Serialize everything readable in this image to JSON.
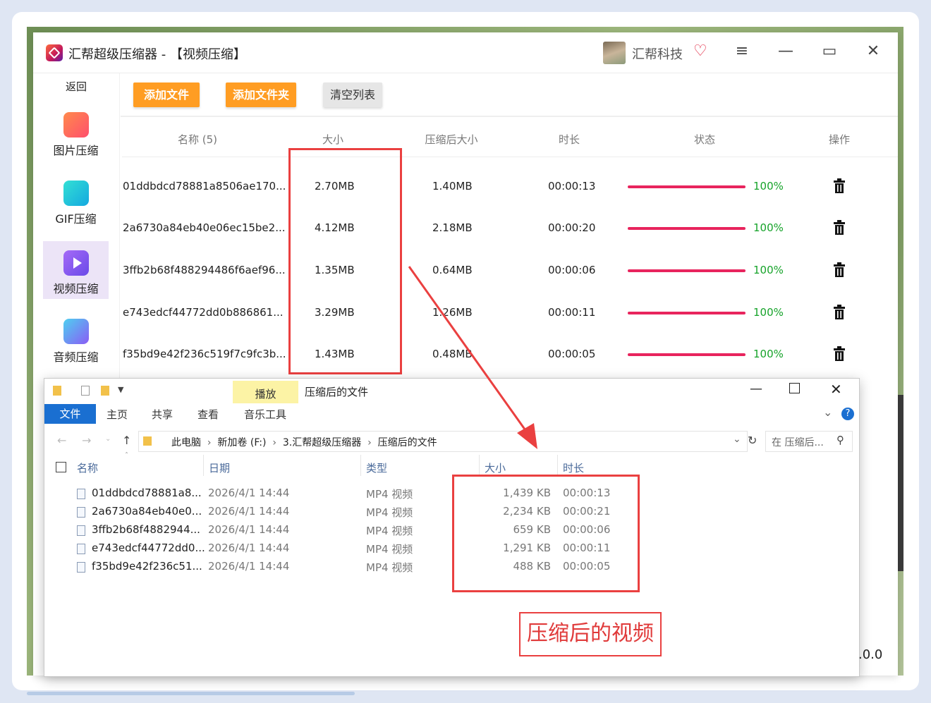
{
  "app": {
    "title": "汇帮超级压缩器 - 【视频压缩】",
    "brand": "汇帮科技",
    "version_fragment": ".0.0"
  },
  "sidebar": {
    "back": "返回",
    "items": [
      {
        "label": "图片压缩",
        "icon": "image-icon",
        "color": "#ff6a5c"
      },
      {
        "label": "GIF压缩",
        "icon": "gif-icon",
        "color": "#1cc7d6"
      },
      {
        "label": "视频压缩",
        "icon": "video-play-icon",
        "color": "#8a5cf5"
      },
      {
        "label": "音频压缩",
        "icon": "audio-icon",
        "color": "#6b7cf5"
      }
    ]
  },
  "toolbar": {
    "add_file": "添加文件",
    "add_folder": "添加文件夹",
    "clear_list": "清空列表"
  },
  "table": {
    "headers": [
      "名称 (5)",
      "大小",
      "压缩后大小",
      "时长",
      "状态",
      "操作"
    ],
    "rows": [
      {
        "name": "01ddbdcd78881a8506ae170...",
        "size": "2.70MB",
        "compressed": "1.40MB",
        "duration": "00:00:13",
        "progress": 1.0,
        "status": "100%"
      },
      {
        "name": "2a6730a84eb40e06ec15be2...",
        "size": "4.12MB",
        "compressed": "2.18MB",
        "duration": "00:00:20",
        "progress": 1.0,
        "status": "100%"
      },
      {
        "name": "3ffb2b68f488294486f6aef96...",
        "size": "1.35MB",
        "compressed": "0.64MB",
        "duration": "00:00:06",
        "progress": 1.0,
        "status": "100%"
      },
      {
        "name": "e743edcf44772dd0b886861...",
        "size": "3.29MB",
        "compressed": "1.26MB",
        "duration": "00:00:11",
        "progress": 1.0,
        "status": "100%"
      },
      {
        "name": "f35bd9e42f236c519f7c9fc3b...",
        "size": "1.43MB",
        "compressed": "0.48MB",
        "duration": "00:00:05",
        "progress": 1.0,
        "status": "100%"
      }
    ]
  },
  "explorer": {
    "title": "压缩后的文件",
    "play_tab": "播放",
    "ribbon_tabs": [
      "文件",
      "主页",
      "共享",
      "查看",
      "音乐工具"
    ],
    "path": [
      "此电脑",
      "新加卷 (F:)",
      "3.汇帮超级压缩器",
      "压缩后的文件"
    ],
    "search_placeholder": "在 压缩后...",
    "columns": [
      "名称",
      "日期",
      "类型",
      "大小",
      "时长"
    ],
    "files": [
      {
        "name": "01ddbdcd78881a8...",
        "date": "2026/4/1 14:44",
        "type": "MP4 视频",
        "size": "1,439 KB",
        "duration": "00:00:13"
      },
      {
        "name": "2a6730a84eb40e0...",
        "date": "2026/4/1 14:44",
        "type": "MP4 视频",
        "size": "2,234 KB",
        "duration": "00:00:21"
      },
      {
        "name": "3ffb2b68f4882944...",
        "date": "2026/4/1 14:44",
        "type": "MP4 视频",
        "size": "659 KB",
        "duration": "00:00:06"
      },
      {
        "name": "e743edcf44772dd0...",
        "date": "2026/4/1 14:44",
        "type": "MP4 视频",
        "size": "1,291 KB",
        "duration": "00:00:11"
      },
      {
        "name": "f35bd9e42f236c51...",
        "date": "2026/4/1 14:44",
        "type": "MP4 视频",
        "size": "488 KB",
        "duration": "00:00:05"
      }
    ]
  },
  "annotation": {
    "caption": "压缩后的视频",
    "color": "#ea4040"
  },
  "colors": {
    "accent_orange": "#ff9d23",
    "progress": "#e8245d",
    "success": "#16a32a",
    "explorer_blue": "#1a6fd1"
  }
}
